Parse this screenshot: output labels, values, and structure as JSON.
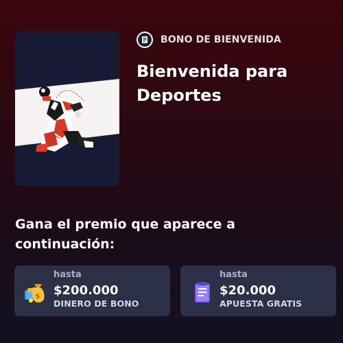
{
  "header": {
    "badge_label": "BONO DE BIENVENIDA",
    "badge_icon": "sports-ticket-icon"
  },
  "promo": {
    "title_line1": "Bienvenida para",
    "title_line2": "Deportes",
    "image": "soccer-player-bicycle-kick-illustration"
  },
  "rewards": {
    "prompt_line1": "Gana el premio que aparece a",
    "prompt_line2": "continuación:",
    "items": [
      {
        "prefix": "hasta",
        "amount": "$200.000",
        "label": "DINERO DE BONO",
        "icon": "money-bag-icon"
      },
      {
        "prefix": "hasta",
        "amount": "$20.000",
        "label": "APUESTA GRATIS",
        "icon": "free-bet-slip-icon"
      }
    ]
  },
  "colors": {
    "background_top": "#3a050b",
    "background_bottom": "#141122",
    "card": "#2c3046",
    "promo_card": "#181b33"
  }
}
